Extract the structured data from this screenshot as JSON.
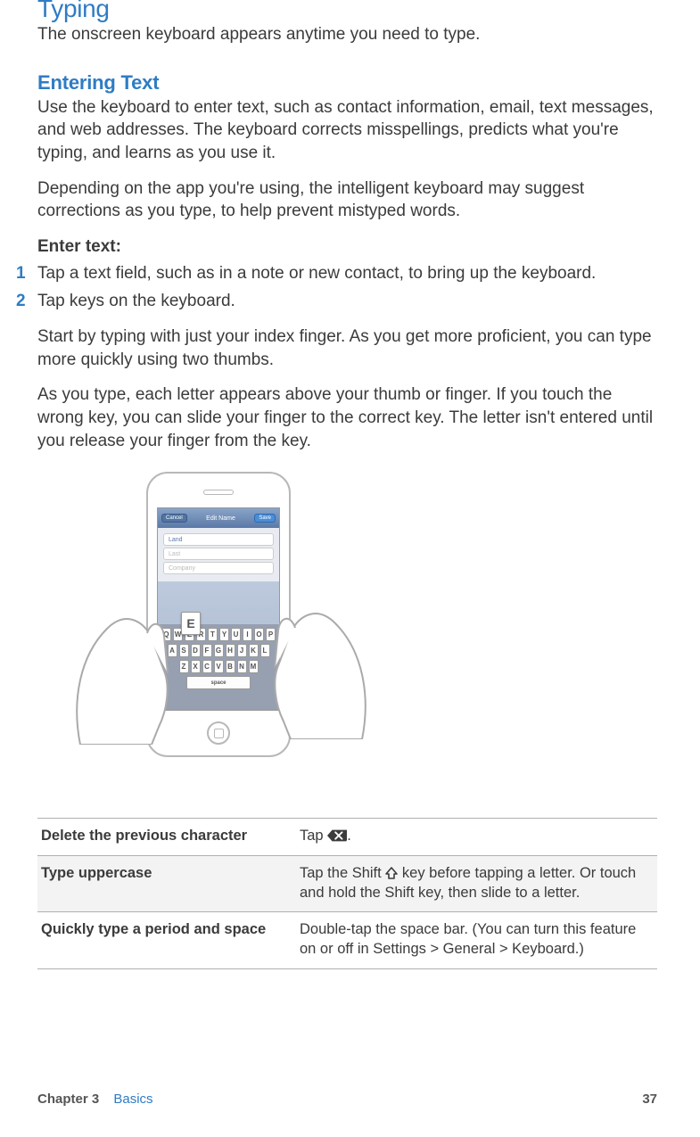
{
  "section": {
    "title": "Typing",
    "intro": "The onscreen keyboard appears anytime you need to type."
  },
  "subsection": {
    "title": "Entering Text",
    "p1": "Use the keyboard to enter text, such as contact information, email, text messages, and web addresses. The keyboard corrects misspellings, predicts what you're typing, and learns as you use it.",
    "p2": "Depending on the app you're using, the intelligent keyboard may suggest corrections as you type, to help prevent mistyped words.",
    "lead": "Enter text:",
    "step1_num": "1",
    "step1": "Tap a text field, such as in a note or new contact, to bring up the keyboard.",
    "step2_num": "2",
    "step2": "Tap keys on the keyboard.",
    "p3": "Start by typing with just your index finger. As you get more proficient, you can type more quickly using two thumbs.",
    "p4": "As you type, each letter appears above your thumb or finger. If you touch the wrong key, you can slide your finger to the correct key. The letter isn't entered until you release your finger from the key."
  },
  "figure": {
    "nav_cancel": "Cancel",
    "nav_title": "Edit Name",
    "nav_save": "Save",
    "field_first": "Land",
    "field_last": "Last",
    "field_company": "Company",
    "popup_key": "E",
    "space": "space",
    "row1": [
      "Q",
      "W",
      "E",
      "R",
      "T",
      "Y",
      "U",
      "I",
      "O",
      "P"
    ],
    "row2": [
      "A",
      "S",
      "D",
      "F",
      "G",
      "H",
      "J",
      "K",
      "L"
    ],
    "row3": [
      "Z",
      "X",
      "C",
      "V",
      "B",
      "N",
      "M"
    ]
  },
  "table": {
    "r1_label": "Delete the previous character",
    "r1_pre": "Tap ",
    "r1_post": ".",
    "r2_label": "Type uppercase",
    "r2_pre": "Tap the Shift ",
    "r2_post": " key before tapping a letter. Or touch and hold the Shift key, then slide to a letter.",
    "r3_label": "Quickly type a period and space",
    "r3_text": "Double-tap the space bar. (You can turn this feature on or off in Settings > General > Keyboard.)"
  },
  "footer": {
    "chapter": "Chapter 3",
    "chapter_title": "Basics",
    "page": "37"
  }
}
